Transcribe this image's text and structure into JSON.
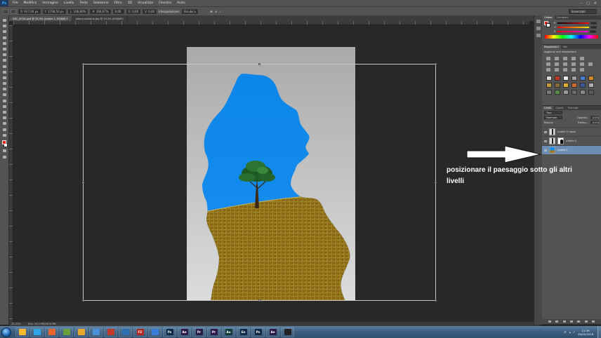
{
  "menu": {
    "app_logo": "Ps",
    "items": [
      "File",
      "Modifica",
      "Immagine",
      "Livello",
      "Testo",
      "Selezione",
      "Filtro",
      "3D",
      "Visualizza",
      "Finestra",
      "Aiuto"
    ]
  },
  "options_bar": {
    "x": "X: 917,00 px",
    "y": "Y: 1738,50 px",
    "w": "L: 166,80%",
    "h": "A: 166,67%",
    "rotate": "0,00",
    "h_skew": "O: 0,00",
    "v_skew": "V: 0,00",
    "interp_label": "Interpolazione:",
    "interp_value": "Bicubica",
    "workspace": "Essenziali"
  },
  "doc_tabs": [
    {
      "label": "DSC_8734.psd @ 33,3% (Livello 1, RGB/8) *",
      "active": true
    },
    {
      "label": "albero-solitario.jpg @ 33,3% (RGB/8*)",
      "active": false
    }
  ],
  "status": {
    "zoom": "33,33%",
    "doc": "Doc: 26,0 MB/38,6 MB"
  },
  "annotation": {
    "text": "posizionare il paesaggio sotto gli altri livelli"
  },
  "color_panel": {
    "tabs": [
      "Colore",
      "Campioni"
    ],
    "channels": [
      "R",
      "G",
      "B"
    ]
  },
  "adjust_panel": {
    "tabs": [
      "Regolazioni",
      "Stili"
    ],
    "heading": "Aggiungi una regolazione"
  },
  "layers_panel": {
    "tabs": [
      "Livelli",
      "Canali",
      "Tracciati"
    ],
    "filter": "Tipo",
    "blend_mode": "Normale",
    "opacity_label": "Opacità:",
    "opacity_value": "100%",
    "lock_label": "Blocca:",
    "fill_label": "Riemp.:",
    "fill_value": "100%",
    "layers": [
      {
        "name": "Livello 0 copia",
        "selected": false,
        "has_mask": false
      },
      {
        "name": "Livello 0",
        "selected": false,
        "has_mask": true
      },
      {
        "name": "Livello 1",
        "selected": true,
        "has_mask": false
      }
    ]
  },
  "taskbar": {
    "apps": [
      {
        "label": "",
        "color": "#f5b82e"
      },
      {
        "label": "",
        "color": "#2ea6e8"
      },
      {
        "label": "",
        "color": "#e8662e"
      },
      {
        "label": "",
        "color": "#6aa13f"
      },
      {
        "label": "",
        "color": "#e8a82e"
      },
      {
        "label": "",
        "color": "#4a90d9"
      },
      {
        "label": "",
        "color": "#c0392b"
      },
      {
        "label": "",
        "color": "#2c6fb3"
      },
      {
        "label": "FZ",
        "color": "#b3261e"
      },
      {
        "label": "",
        "color": "#3a7bd5"
      },
      {
        "label": "Ps",
        "color": "#0e2a47"
      },
      {
        "label": "Ae",
        "color": "#2a1a4a"
      },
      {
        "label": "Pr",
        "color": "#2a1a4a"
      },
      {
        "label": "Pr",
        "color": "#2a1a4a"
      },
      {
        "label": "Au",
        "color": "#0e3a3a"
      },
      {
        "label": "En",
        "color": "#0e2a47"
      },
      {
        "label": "Ps",
        "color": "#0e2a47"
      },
      {
        "label": "Ae",
        "color": "#2a1a4a"
      },
      {
        "label": "",
        "color": "#222222"
      }
    ],
    "lang": "IT",
    "time": "21:39",
    "date": "09/01/2016"
  },
  "colors": {
    "selection_blue": "#6e8db4",
    "foreground": "#e8231c",
    "background": "#ffffff",
    "sky": "#0a86e8",
    "field": "#9a7a1c"
  }
}
